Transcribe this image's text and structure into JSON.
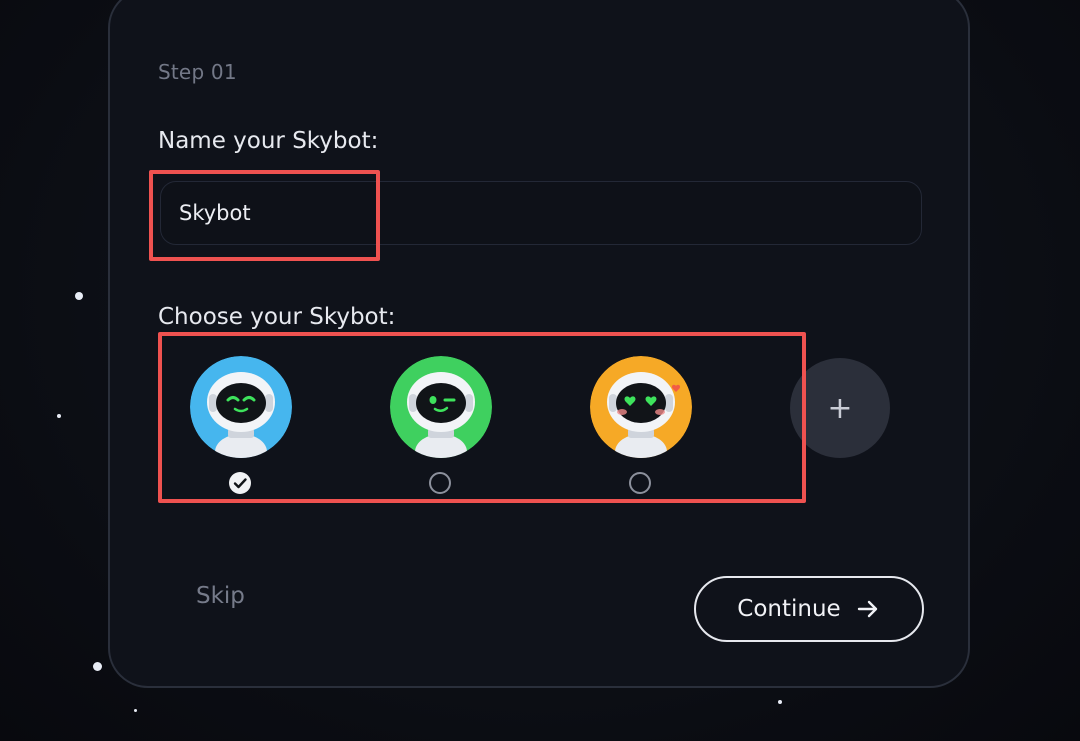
{
  "step": {
    "label": "Step 01"
  },
  "name_section": {
    "label": "Name your Skybot:",
    "input_value": "Skybot"
  },
  "choose_section": {
    "label": "Choose your Skybot:",
    "avatars": [
      {
        "name": "robot-blue",
        "background": "#46b6ee",
        "selected": true
      },
      {
        "name": "robot-green",
        "background": "#3fd05f",
        "selected": false
      },
      {
        "name": "robot-orange",
        "background": "#f6a926",
        "selected": false
      }
    ],
    "add_icon": "plus-icon"
  },
  "actions": {
    "skip_label": "Skip",
    "continue_label": "Continue",
    "continue_icon": "arrow-right-icon"
  },
  "colors": {
    "background": "#0c0e14",
    "card_border": "#2a2f3b",
    "highlight": "#ef5250",
    "accent_text": "#e7e9ef"
  }
}
